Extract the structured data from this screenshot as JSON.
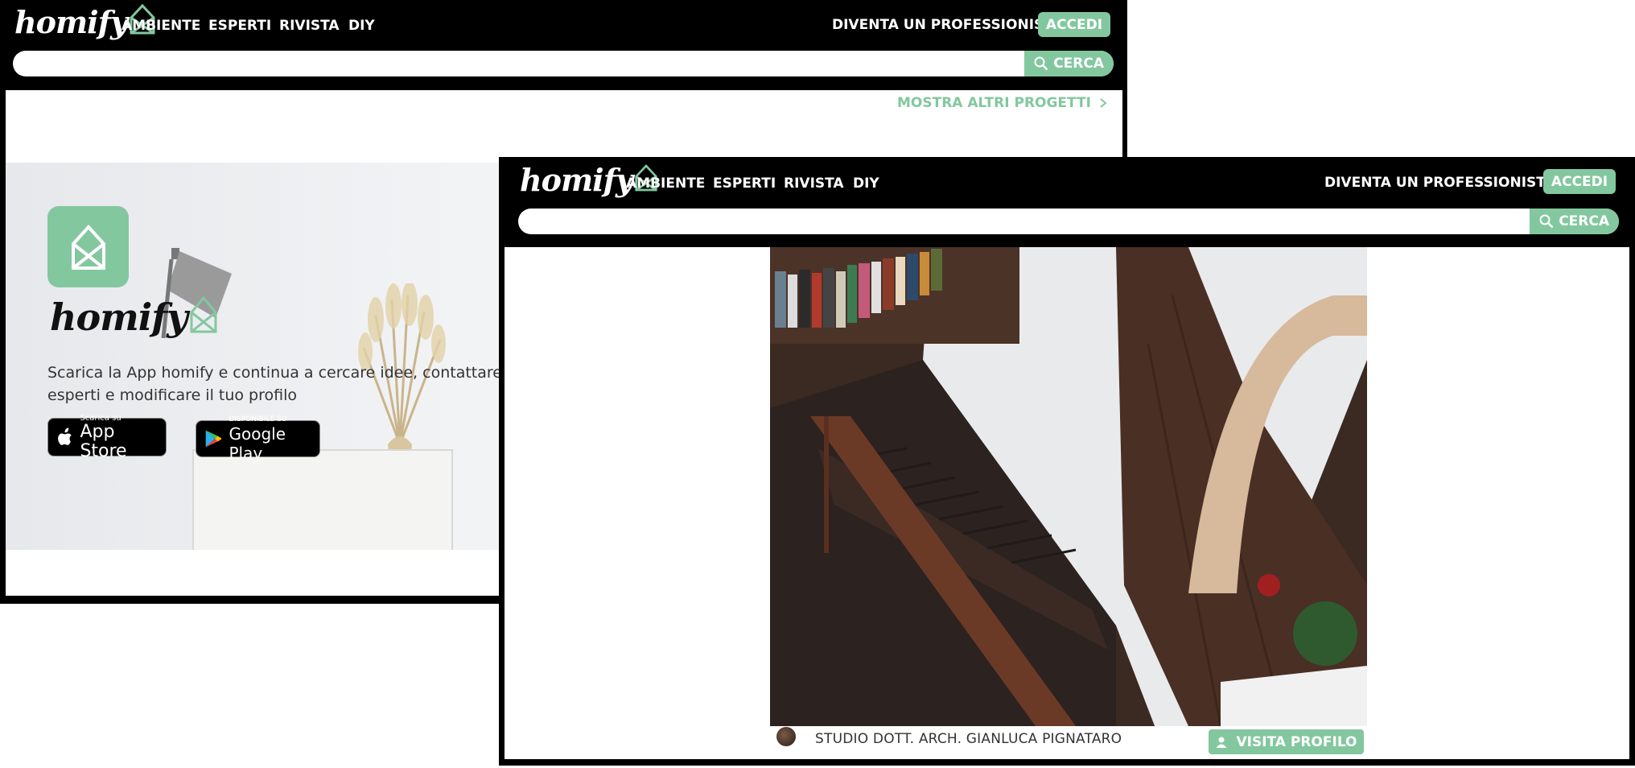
{
  "brand": {
    "logo_text": "homify",
    "accent_color": "#83c79f"
  },
  "nav": {
    "items": [
      "AMBIENTE",
      "ESPERTI",
      "RIVISTA",
      "DIY"
    ],
    "pro_link": "DIVENTA UN PROFESSIONISTA",
    "login_label": "ACCEDI"
  },
  "search": {
    "placeholder": "",
    "value": "",
    "button_label": "CERCA",
    "button_icon": "search-icon"
  },
  "window_back": {
    "more_projects_label": "MOSTRA ALTRI PROGETTI",
    "app_banner": {
      "logo_text": "homify",
      "text": "Scarica la App homify e continua a cercare idee, contattare esperti e modificare il tuo profilo",
      "app_store": {
        "small": "Scarica su",
        "big": "App Store"
      },
      "google_play": {
        "small": "DISPONIBILE SU",
        "big": "Google Play"
      }
    }
  },
  "window_front": {
    "professional_name": "STUDIO DOTT. ARCH. GIANLUCA PIGNATARO",
    "visit_profile_label": "VISITA PROFILO"
  }
}
